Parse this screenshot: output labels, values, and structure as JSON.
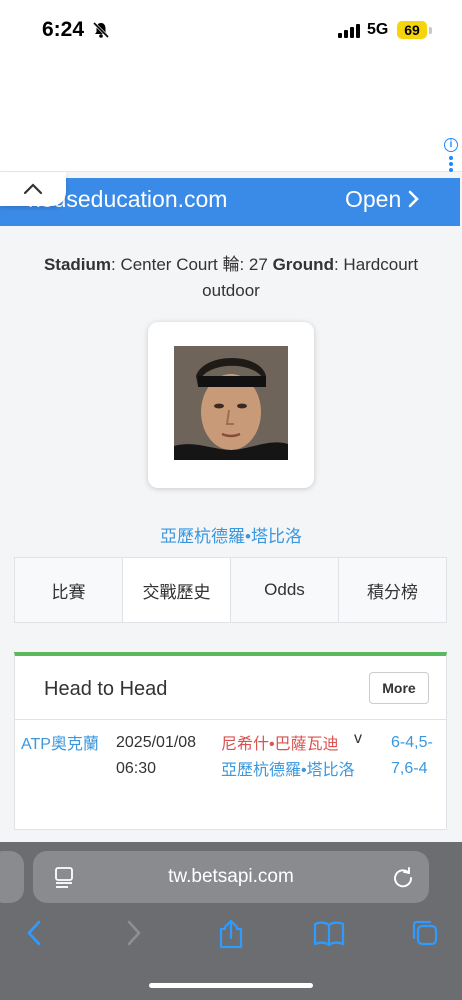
{
  "status_bar": {
    "time": "6:24",
    "network": "5G",
    "battery": "69"
  },
  "ad": {
    "domain": "houseducation.com",
    "open_label": "Open",
    "info_glyph": "i"
  },
  "match_info": {
    "stadium_label": "Stadium",
    "stadium_value": ": Center Court 輪: 27 ",
    "ground_label": "Ground",
    "ground_value": ": Hardcourt outdoor"
  },
  "player": {
    "name": "亞歷杭德羅•塔比洛"
  },
  "tabs": [
    {
      "label": "比賽"
    },
    {
      "label": "交戰歷史"
    },
    {
      "label": "Odds"
    },
    {
      "label": "積分榜"
    }
  ],
  "h2h": {
    "title": "Head to Head",
    "more_label": "More",
    "rows": [
      {
        "league": "ATP奧克蘭",
        "date": "2025/01/08 06:30",
        "player1": "尼希什•巴薩瓦迪",
        "vs": "v",
        "player2": "亞歷杭德羅•塔比洛",
        "score": "6-4,5-7,6-4"
      }
    ]
  },
  "browser": {
    "url": "tw.betsapi.com"
  },
  "colors": {
    "ad_banner": "#3a8ae8",
    "link_blue": "#3b97de",
    "loser_red": "#d9534f",
    "h2h_accent": "#5cb85c"
  }
}
